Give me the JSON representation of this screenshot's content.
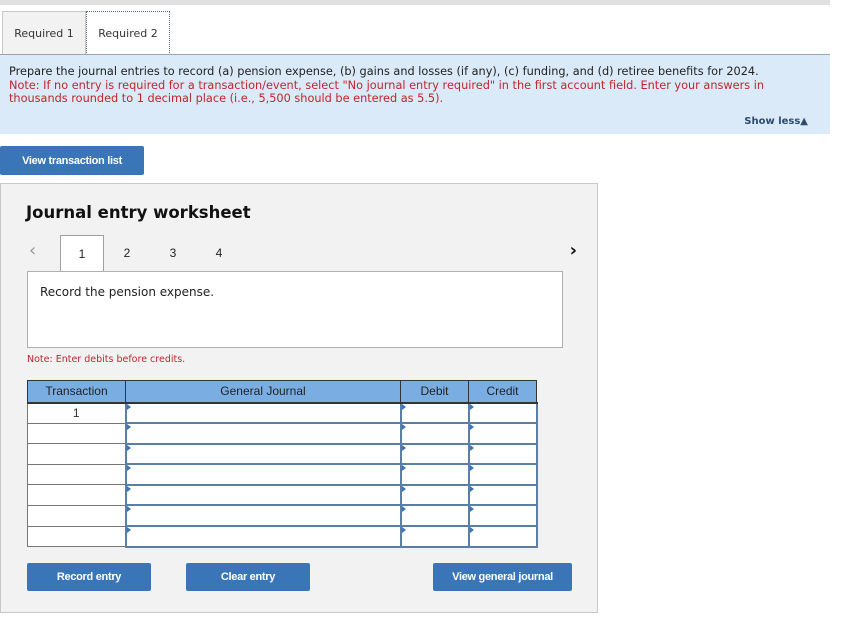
{
  "tabs": [
    {
      "label": "Required 1",
      "active": false
    },
    {
      "label": "Required 2",
      "active": true
    }
  ],
  "instructions": {
    "main": "Prepare the journal entries to record (a) pension expense, (b) gains and losses (if any), (c) funding, and (d) retiree benefits for 2024.",
    "note": "Note: If no entry is required for a transaction/event, select \"No journal entry required\" in the first account field. Enter your answers in thousands rounded to 1 decimal place (i.e., 5,500 should be entered as 5.5).",
    "show_less": "Show less▲"
  },
  "buttons": {
    "view_transaction_list": "View transaction list",
    "record_entry": "Record entry",
    "clear_entry": "Clear entry",
    "view_general_journal": "View general journal"
  },
  "worksheet": {
    "title": "Journal entry worksheet",
    "pager": {
      "prev": "‹",
      "next": "›",
      "pages": [
        "1",
        "2",
        "3",
        "4"
      ],
      "active_page": "1"
    },
    "prompt": "Record the pension expense.",
    "debits_note": "Note: Enter debits before credits."
  },
  "table": {
    "headers": {
      "transaction": "Transaction",
      "general_journal": "General Journal",
      "debit": "Debit",
      "credit": "Credit"
    },
    "rows": [
      {
        "transaction": "1",
        "account": "",
        "debit": "",
        "credit": ""
      },
      {
        "transaction": "",
        "account": "",
        "debit": "",
        "credit": ""
      },
      {
        "transaction": "",
        "account": "",
        "debit": "",
        "credit": ""
      },
      {
        "transaction": "",
        "account": "",
        "debit": "",
        "credit": ""
      },
      {
        "transaction": "",
        "account": "",
        "debit": "",
        "credit": ""
      },
      {
        "transaction": "",
        "account": "",
        "debit": "",
        "credit": ""
      },
      {
        "transaction": "",
        "account": "",
        "debit": "",
        "credit": ""
      }
    ]
  }
}
